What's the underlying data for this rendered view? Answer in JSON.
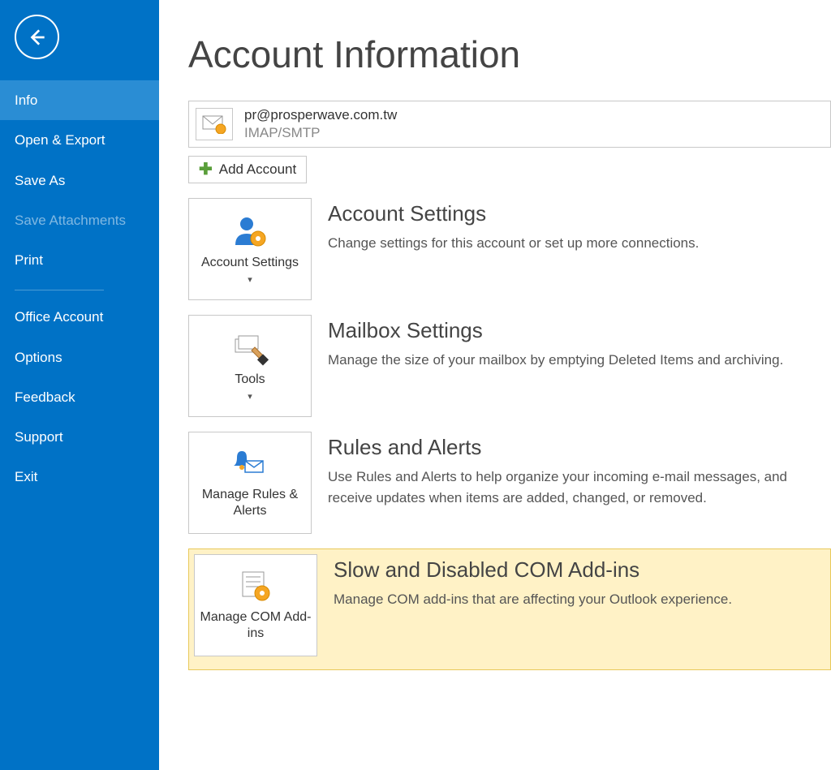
{
  "sidebar": {
    "items": [
      {
        "label": "Info",
        "state": "active"
      },
      {
        "label": "Open & Export",
        "state": ""
      },
      {
        "label": "Save As",
        "state": ""
      },
      {
        "label": "Save Attachments",
        "state": "disabled"
      },
      {
        "label": "Print",
        "state": ""
      }
    ],
    "lower_items": [
      {
        "label": "Office Account"
      },
      {
        "label": "Options"
      },
      {
        "label": "Feedback"
      },
      {
        "label": "Support"
      },
      {
        "label": "Exit"
      }
    ]
  },
  "page": {
    "title": "Account Information",
    "account_email": "pr@prosperwave.com.tw",
    "account_protocol": "IMAP/SMTP",
    "add_account_label": "Add Account"
  },
  "sections": [
    {
      "button_label": "Account Settings",
      "title": "Account Settings",
      "desc": "Change settings for this account or set up more connections.",
      "has_caret": true
    },
    {
      "button_label": "Tools",
      "title": "Mailbox Settings",
      "desc": "Manage the size of your mailbox by emptying Deleted Items and archiving.",
      "has_caret": true
    },
    {
      "button_label": "Manage Rules & Alerts",
      "title": "Rules and Alerts",
      "desc": "Use Rules and Alerts to help organize your incoming e-mail messages, and receive updates when items are added, changed, or removed.",
      "has_caret": false
    },
    {
      "button_label": "Manage COM Add-ins",
      "title": "Slow and Disabled COM Add-ins",
      "desc": "Manage COM add-ins that are affecting your Outlook experience.",
      "has_caret": false,
      "highlighted": true
    }
  ]
}
